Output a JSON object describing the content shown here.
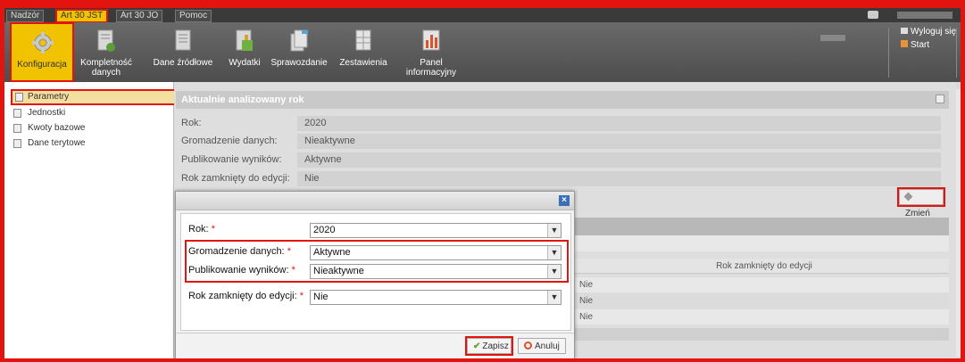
{
  "nav": {
    "tabs": [
      {
        "label": "Nadzór",
        "active": false
      },
      {
        "label": "Art 30 JST",
        "active": true
      },
      {
        "label": "Art 30 JO",
        "active": false
      },
      {
        "label": "Pomoc",
        "active": false
      }
    ]
  },
  "ribbon": {
    "items": [
      {
        "label": "Konfiguracja",
        "icon": "gear-icon",
        "active": true
      },
      {
        "label": "Kompletność danych",
        "icon": "document-check-icon",
        "active": false
      },
      {
        "label": "Dane źródłowe",
        "icon": "document-icon",
        "active": false
      },
      {
        "label": "Wydatki",
        "icon": "document-chart-icon",
        "active": false
      },
      {
        "label": "Sprawozdanie",
        "icon": "report-icon",
        "active": false
      },
      {
        "label": "Zestawienia",
        "icon": "spreadsheet-icon",
        "active": false
      },
      {
        "label": "Panel informacyjny",
        "icon": "bar-chart-icon",
        "active": false
      }
    ],
    "logout_label": "Wyloguj się",
    "start_label": "Start"
  },
  "sidebar": {
    "items": [
      {
        "label": "Parametry",
        "selected": true
      },
      {
        "label": "Jednostki",
        "selected": false
      },
      {
        "label": "Kwoty bazowe",
        "selected": false
      },
      {
        "label": "Dane terytowe",
        "selected": false
      }
    ]
  },
  "panel": {
    "title": "Aktualnie analizowany rok",
    "rows": [
      {
        "label": "Rok:",
        "value": "2020"
      },
      {
        "label": "Gromadzenie danych:",
        "value": "Nieaktywne"
      },
      {
        "label": "Publikowanie wyników:",
        "value": "Aktywne"
      },
      {
        "label": "Rok zamknięty do edycji:",
        "value": "Nie"
      }
    ],
    "change_button": "Zmień"
  },
  "table": {
    "column_header": "Rok zamknięty do edycji",
    "cells": [
      "Nie",
      "Nie",
      "Nie"
    ]
  },
  "modal": {
    "fields": [
      {
        "label": "Rok:",
        "required_mark": "*",
        "value": "2020"
      },
      {
        "label": "Gromadzenie danych:",
        "required_mark": "*",
        "value": "Aktywne"
      },
      {
        "label": "Publikowanie wyników:",
        "required_mark": "*",
        "value": "Nieaktywne"
      },
      {
        "label": "Rok zamknięty do edycji:",
        "required_mark": "*",
        "value": "Nie"
      }
    ],
    "save_button": "Zapisz",
    "cancel_button": "Anuluj"
  },
  "colors": {
    "highlight_red": "#e3140f",
    "active_yellow": "#f0c200",
    "ribbon_dark": "#4d4d4d"
  }
}
